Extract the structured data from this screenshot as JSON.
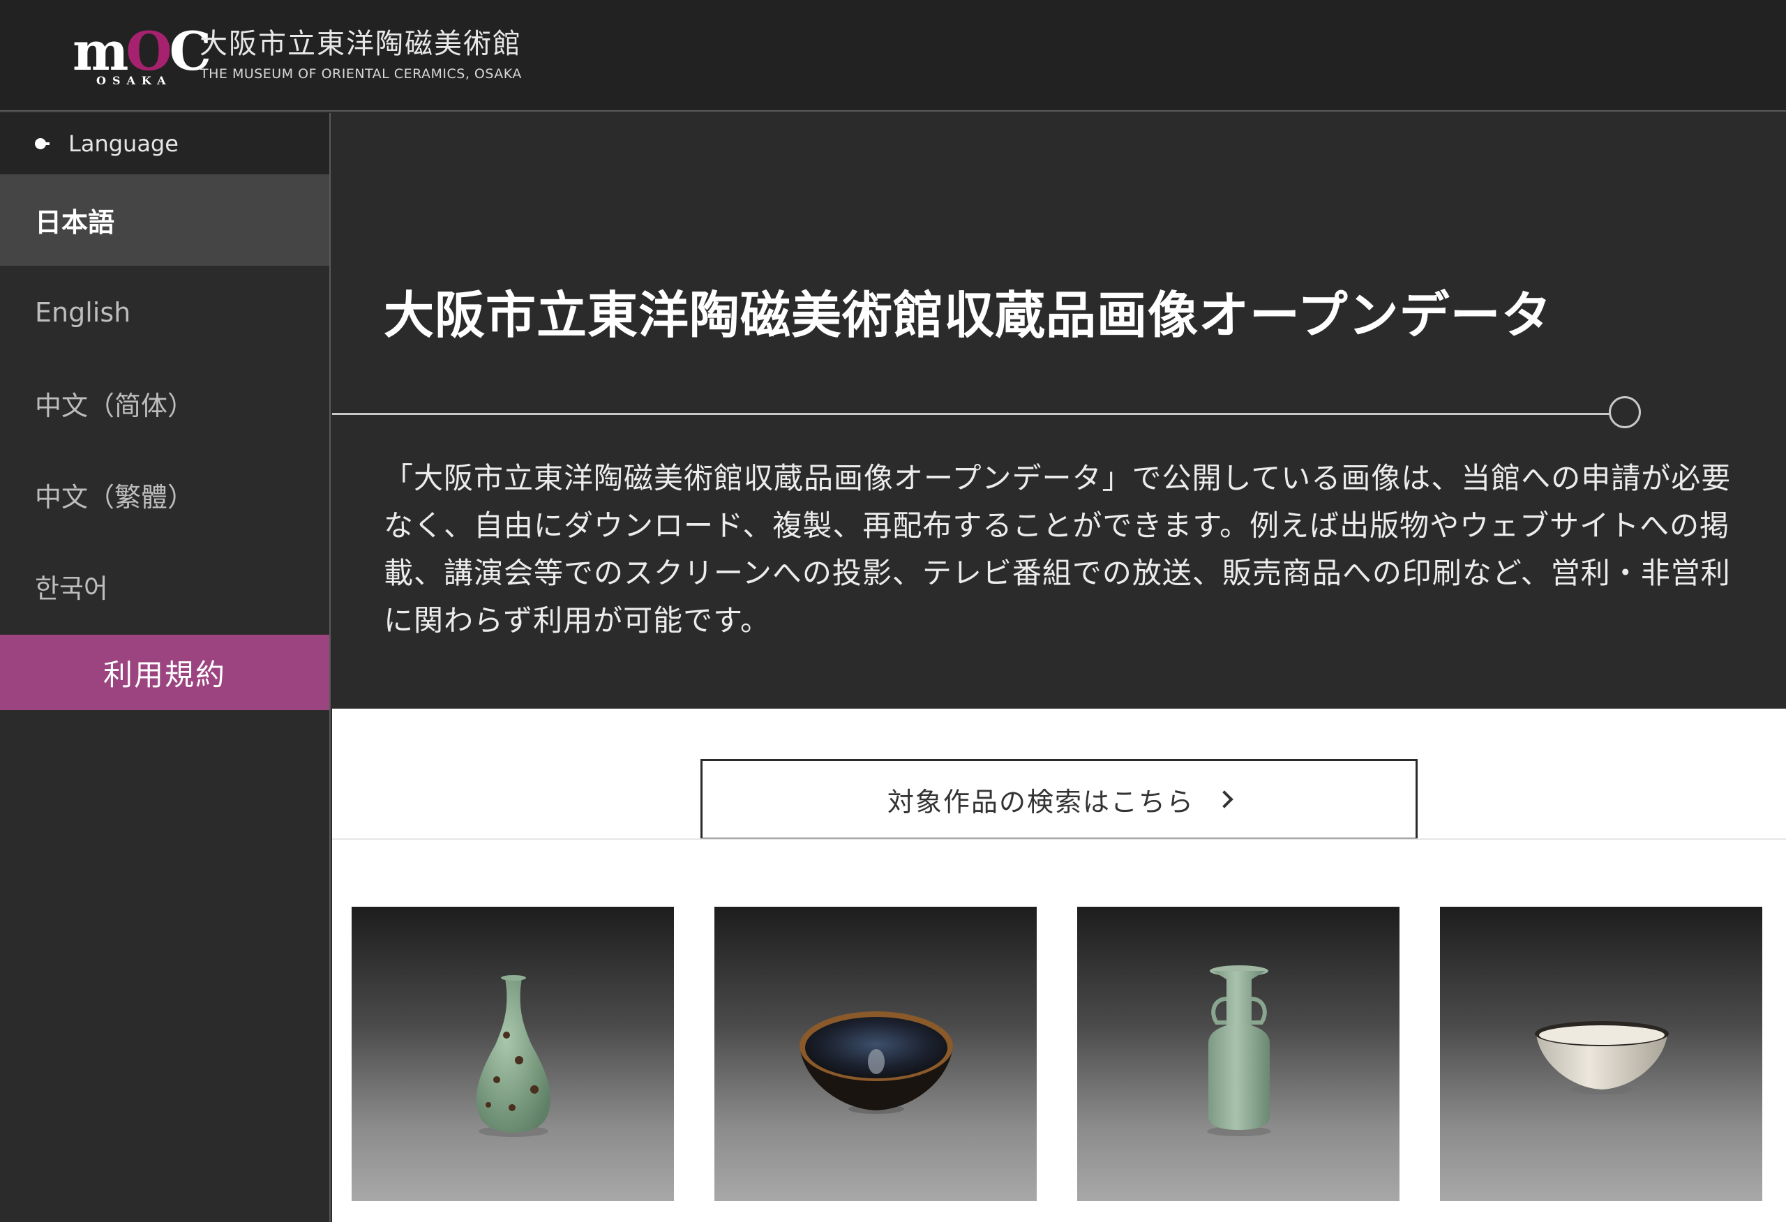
{
  "header": {
    "logo": {
      "letters": [
        "m",
        "O",
        "C"
      ],
      "sub": "OSAKA"
    },
    "brand_ja": "大阪市立東洋陶磁美術館",
    "brand_en": "THE MUSEUM OF ORIENTAL CERAMICS, OSAKA"
  },
  "sidebar": {
    "language_label": "Language",
    "languages": [
      {
        "label": "日本語",
        "active": true
      },
      {
        "label": "English",
        "active": false
      },
      {
        "label": "中文（简体）",
        "active": false
      },
      {
        "label": "中文（繁體）",
        "active": false
      },
      {
        "label": "한국어",
        "active": false
      }
    ],
    "terms_label": "利用規約"
  },
  "main": {
    "title": "大阪市立東洋陶磁美術館収蔵品画像オープンデータ",
    "intro": "「大阪市立東洋陶磁美術館収蔵品画像オープンデータ」で公開している画像は、当館への申請が必要なく、自由にダウンロード、複製、再配布することができます。例えば出版物やウェブサイトへの掲載、講演会等でのスクリーンへの投影、テレビ番組での放送、販売商品への印刷など、営利・非営利に関わらず利用が可能です。",
    "search_button": "対象作品の検索はこちら"
  },
  "colors": {
    "accent": "#9b4480",
    "logo_o": "#a6226f",
    "header_bg": "#222222",
    "body_bg": "#2b2b2b"
  },
  "thumbnails": [
    {
      "icon": "celadon-vase-icon"
    },
    {
      "icon": "tenmoku-bowl-icon"
    },
    {
      "icon": "celadon-mallet-vase-icon"
    },
    {
      "icon": "white-bowl-icon"
    }
  ]
}
